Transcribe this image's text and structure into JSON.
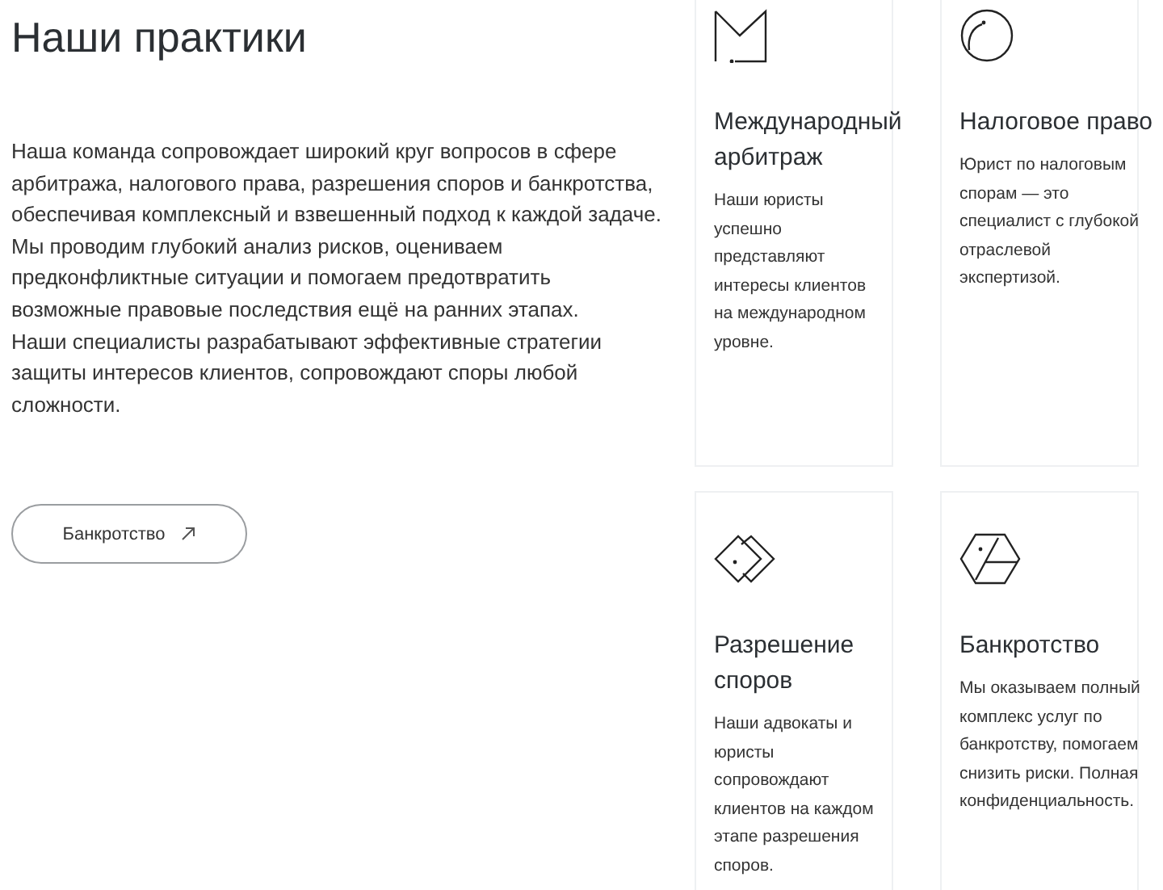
{
  "heading": "Наши практики",
  "paragraphs": [
    "Наша команда сопровождает широкий круг вопросов в сфере арбитража, налогового права, разрешения споров и банкротства, обеспечивая комплексный и взвешенный подход к каждой задаче. Мы проводим глубокий анализ рисков, оцениваем предконфликтные ситуации и помогаем предотвратить возможные правовые последствия ещё на ранних этапах.",
    "Наши специалисты разрабатывают эффективные стратегии защиты интересов клиентов, сопровождают споры любой сложности."
  ],
  "button": {
    "label": "Банкротство"
  },
  "cards": [
    {
      "kind": "envelope",
      "title": "Международный арбитраж",
      "text": "Наши юристы успешно представляют интересы клиентов на международном уровне."
    },
    {
      "kind": "circle",
      "title": "Налоговое право",
      "text": "Юрист по налоговым спорам — это специалист с глубокой отраслевой экспертизой."
    },
    {
      "kind": "diamonds",
      "title": "Разрешение споров",
      "text": "Наши адвокаты и юристы сопровождают клиентов на каждом этапе разрешения споров."
    },
    {
      "kind": "hexagon",
      "title": "Банкротство",
      "text": "Мы оказываем полный комплекс услуг по банкротству, помогаем снизить риски. Полная конфиденциальность."
    }
  ]
}
